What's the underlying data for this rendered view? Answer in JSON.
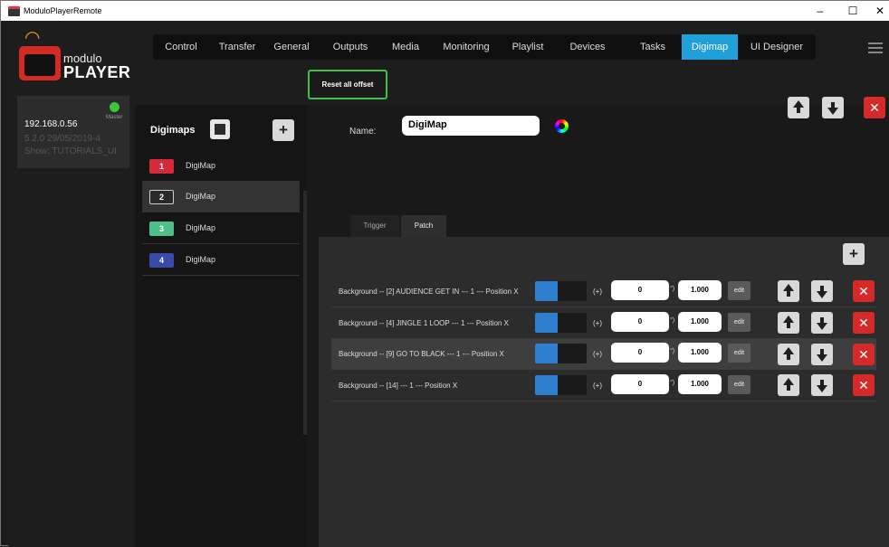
{
  "window": {
    "title": "ModuloPlayerRemote",
    "minimize": "–",
    "maximize": "☐",
    "close": "✕"
  },
  "logo": {
    "line1": "modulo",
    "line2": "PLAYER"
  },
  "tabs": [
    {
      "label": "Control"
    },
    {
      "label": "Transfer"
    },
    {
      "label": "General"
    },
    {
      "label": "Outputs"
    },
    {
      "label": "Media"
    },
    {
      "label": "Monitoring"
    },
    {
      "label": "Playlist"
    },
    {
      "label": "Devices"
    },
    {
      "label": "Tasks"
    },
    {
      "label": "Digimap"
    },
    {
      "label": "UI Designer"
    }
  ],
  "active_tab": "Digimap",
  "accent_color": "#1fa0d8",
  "toolbar": {
    "reset_label": "Reset all offset"
  },
  "device": {
    "ip": "192.168.0.56",
    "status": "Master",
    "version": "5.2.0 29/05/2019-4",
    "show": "Show: TUTORIALS_UI"
  },
  "digimaps": {
    "header": "Digimaps",
    "add_label": "+",
    "items": [
      {
        "num": "1",
        "name": "DigiMap",
        "color": "#d42a3a",
        "selected": false
      },
      {
        "num": "2",
        "name": "DigiMap",
        "color": "#2a2a2a",
        "selected": true
      },
      {
        "num": "3",
        "name": "DigiMap",
        "color": "#4ec08a",
        "selected": false
      },
      {
        "num": "4",
        "name": "DigiMap",
        "color": "#3a4aa8",
        "selected": false
      }
    ]
  },
  "detail": {
    "name_label": "Name:",
    "name_value": "DigiMap",
    "subtabs": [
      {
        "label": "Trigger"
      },
      {
        "label": "Patch"
      }
    ],
    "active_subtab": "Patch",
    "add_label": "+"
  },
  "patch_rows": [
    {
      "text": "Background -- [2]  AUDIENCE GET IN --- 1 --- Position X",
      "plus": "(+)",
      "value": "0",
      "unit": "°)",
      "scale": "1.000",
      "edit": "edit",
      "delete": "✕"
    },
    {
      "text": "Background -- [4]  JINGLE 1 LOOP --- 1 --- Position X",
      "plus": "(+)",
      "value": "0",
      "unit": "°)",
      "scale": "1.000",
      "edit": "edit",
      "delete": "✕"
    },
    {
      "text": "Background -- [9]  GO TO BLACK --- 1 --- Position X",
      "plus": "(+)",
      "value": "0",
      "unit": "°)",
      "scale": "1.000",
      "edit": "edit",
      "delete": "✕"
    },
    {
      "text": "Background -- [14]  --- 1 --- Position X",
      "plus": "(+)",
      "value": "0",
      "unit": "°)",
      "scale": "1.000",
      "edit": "edit",
      "delete": "✕"
    }
  ],
  "top_delete": "✕"
}
